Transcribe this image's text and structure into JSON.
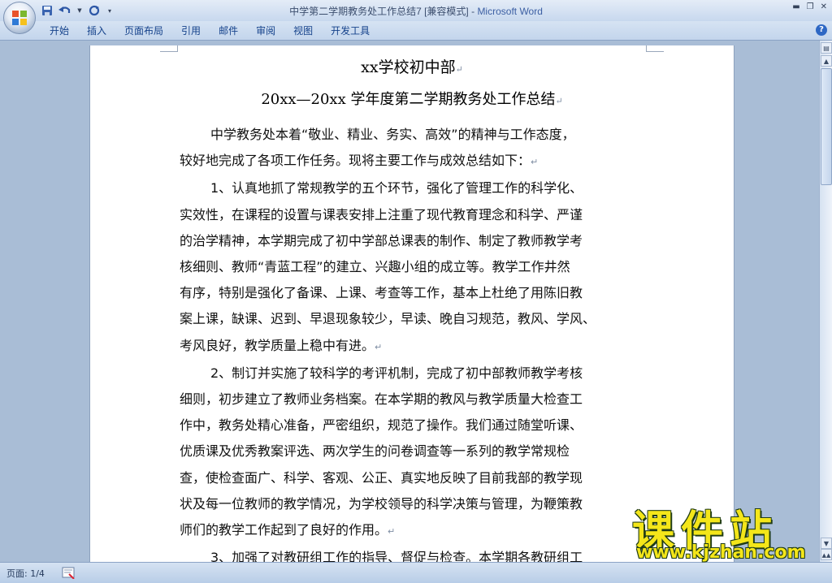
{
  "window": {
    "doc_title": "中学第二学期教务处工作总结7 [兼容模式] - ",
    "app_name": "Microsoft Word"
  },
  "ribbon": {
    "tabs": [
      "开始",
      "插入",
      "页面布局",
      "引用",
      "邮件",
      "审阅",
      "视图",
      "开发工具"
    ]
  },
  "document": {
    "heading1": "xx学校初中部",
    "heading2": "20xx—20xx 学年度第二学期教务处工作总结",
    "lines": [
      "中学教务处本着“敬业、精业、务实、高效”的精神与工作态度，",
      "较好地完成了各项工作任务。现将主要工作与成效总结如下：",
      "1、认真地抓了常规教学的五个环节，强化了管理工作的科学化、",
      "实效性，在课程的设置与课表安排上注重了现代教育理念和科学、严谨",
      "的治学精神，本学期完成了初中学部总课表的制作、制定了教师教学考",
      "核细则、教师“青蓝工程”的建立、兴趣小组的成立等。教学工作井然",
      "有序，特别是强化了备课、上课、考查等工作，基本上杜绝了用陈旧教",
      "案上课，缺课、迟到、早退现象较少，早读、晚自习规范，教风、学风、",
      "考风良好，教学质量上稳中有进。",
      "2、制订并实施了较科学的考评机制，完成了初中部教师教学考核",
      "细则，初步建立了教师业务档案。在本学期的教风与教学质量大检查工",
      "作中，教务处精心准备，严密组织，规范了操作。我们通过随堂听课、",
      "优质课及优秀教案评选、两次学生的问卷调查等一系列的教学常规检",
      "查，使检查面广、科学、客观、公正、真实地反映了目前我部的教学现",
      "状及每一位教师的教学情况，为学校领导的科学决策与管理，为鞭策教",
      "师们的教学工作起到了良好的作用。",
      "3、加强了对教研组工作的指导、督促与检查。本学期各教研组工"
    ],
    "paragraph_mark": "↵"
  },
  "statusbar": {
    "page_label": "页面: 1/4"
  },
  "watermark": {
    "big": "课件站",
    "url": "www.kjzhan.com"
  },
  "icons": {
    "office": "office-button-icon",
    "save": "save-icon",
    "undo": "undo-icon",
    "redo": "redo-icon",
    "help": "help-icon"
  }
}
